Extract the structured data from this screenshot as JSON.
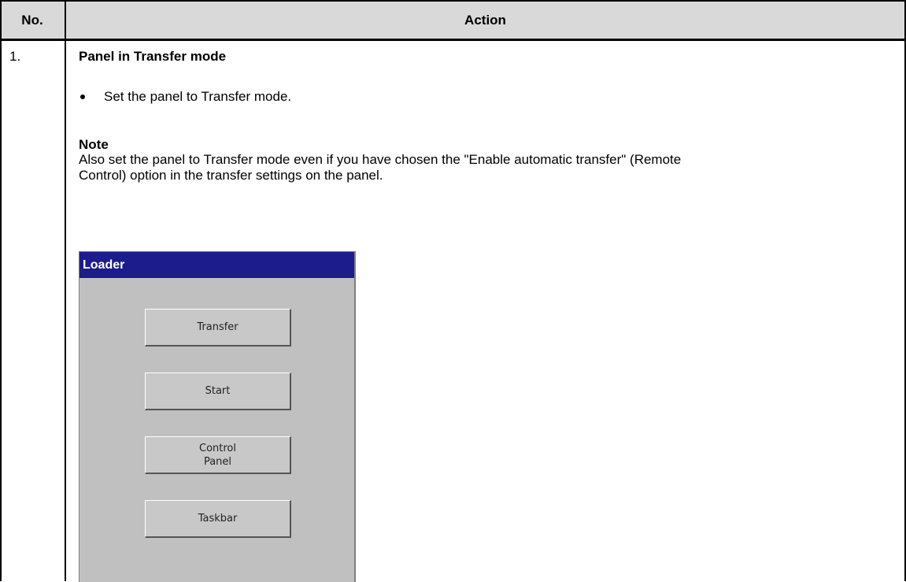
{
  "table": {
    "header": {
      "no": "No.",
      "action": "Action"
    },
    "rows": [
      {
        "no": "1.",
        "title": "Panel in Transfer mode",
        "bullet": "Set the panel to Transfer mode.",
        "note_heading": "Note",
        "note_body": "Also set the panel to Transfer mode even if you have chosen the \"Enable automatic transfer\" (Remote Control) option in the transfer settings on the panel."
      }
    ]
  },
  "loader_dialog": {
    "title": "Loader",
    "title_bar_color": "#1c1c8c",
    "background_color": "#c0c0c0",
    "buttons": [
      "Transfer",
      "Start",
      "Control\nPanel",
      "Taskbar"
    ]
  }
}
